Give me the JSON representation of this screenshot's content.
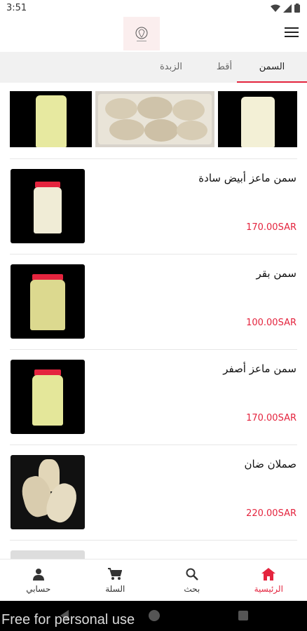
{
  "status_bar": {
    "time": "3:51"
  },
  "tabs": [
    {
      "label": "السمن",
      "active": true
    },
    {
      "label": "أقط",
      "active": false
    },
    {
      "label": "الزبدة",
      "active": false
    }
  ],
  "products": [
    {
      "name": "سمن ماعز أبيض سادة",
      "price": "170.00SAR",
      "image": "white-ghee-jar"
    },
    {
      "name": "سمن بقر",
      "price": "100.00SAR",
      "image": "cow-ghee-jar"
    },
    {
      "name": "سمن ماعز أصفر",
      "price": "170.00SAR",
      "image": "yellow-ghee-jar"
    },
    {
      "name": "صملان ضان",
      "price": "220.00SAR",
      "image": "sheep-skin-bags"
    }
  ],
  "bottom_nav": [
    {
      "label": "الرئيسية",
      "icon": "home-icon",
      "active": true
    },
    {
      "label": "بحث",
      "icon": "search-icon",
      "active": false
    },
    {
      "label": "السلة",
      "icon": "cart-icon",
      "active": false
    },
    {
      "label": "حسابي",
      "icon": "account-icon",
      "active": false
    }
  ],
  "watermark": "Free for personal use",
  "colors": {
    "accent": "#e4243e",
    "tab_bar_bg": "#f1f1f1"
  }
}
